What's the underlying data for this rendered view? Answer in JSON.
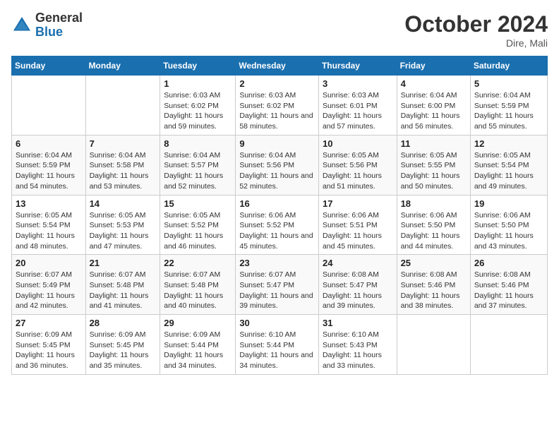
{
  "header": {
    "logo_general": "General",
    "logo_blue": "Blue",
    "month_title": "October 2024",
    "location": "Dire, Mali"
  },
  "days_of_week": [
    "Sunday",
    "Monday",
    "Tuesday",
    "Wednesday",
    "Thursday",
    "Friday",
    "Saturday"
  ],
  "weeks": [
    [
      {
        "day": "",
        "info": ""
      },
      {
        "day": "",
        "info": ""
      },
      {
        "day": "1",
        "info": "Sunrise: 6:03 AM\nSunset: 6:02 PM\nDaylight: 11 hours and 59 minutes."
      },
      {
        "day": "2",
        "info": "Sunrise: 6:03 AM\nSunset: 6:02 PM\nDaylight: 11 hours and 58 minutes."
      },
      {
        "day": "3",
        "info": "Sunrise: 6:03 AM\nSunset: 6:01 PM\nDaylight: 11 hours and 57 minutes."
      },
      {
        "day": "4",
        "info": "Sunrise: 6:04 AM\nSunset: 6:00 PM\nDaylight: 11 hours and 56 minutes."
      },
      {
        "day": "5",
        "info": "Sunrise: 6:04 AM\nSunset: 5:59 PM\nDaylight: 11 hours and 55 minutes."
      }
    ],
    [
      {
        "day": "6",
        "info": "Sunrise: 6:04 AM\nSunset: 5:59 PM\nDaylight: 11 hours and 54 minutes."
      },
      {
        "day": "7",
        "info": "Sunrise: 6:04 AM\nSunset: 5:58 PM\nDaylight: 11 hours and 53 minutes."
      },
      {
        "day": "8",
        "info": "Sunrise: 6:04 AM\nSunset: 5:57 PM\nDaylight: 11 hours and 52 minutes."
      },
      {
        "day": "9",
        "info": "Sunrise: 6:04 AM\nSunset: 5:56 PM\nDaylight: 11 hours and 52 minutes."
      },
      {
        "day": "10",
        "info": "Sunrise: 6:05 AM\nSunset: 5:56 PM\nDaylight: 11 hours and 51 minutes."
      },
      {
        "day": "11",
        "info": "Sunrise: 6:05 AM\nSunset: 5:55 PM\nDaylight: 11 hours and 50 minutes."
      },
      {
        "day": "12",
        "info": "Sunrise: 6:05 AM\nSunset: 5:54 PM\nDaylight: 11 hours and 49 minutes."
      }
    ],
    [
      {
        "day": "13",
        "info": "Sunrise: 6:05 AM\nSunset: 5:54 PM\nDaylight: 11 hours and 48 minutes."
      },
      {
        "day": "14",
        "info": "Sunrise: 6:05 AM\nSunset: 5:53 PM\nDaylight: 11 hours and 47 minutes."
      },
      {
        "day": "15",
        "info": "Sunrise: 6:05 AM\nSunset: 5:52 PM\nDaylight: 11 hours and 46 minutes."
      },
      {
        "day": "16",
        "info": "Sunrise: 6:06 AM\nSunset: 5:52 PM\nDaylight: 11 hours and 45 minutes."
      },
      {
        "day": "17",
        "info": "Sunrise: 6:06 AM\nSunset: 5:51 PM\nDaylight: 11 hours and 45 minutes."
      },
      {
        "day": "18",
        "info": "Sunrise: 6:06 AM\nSunset: 5:50 PM\nDaylight: 11 hours and 44 minutes."
      },
      {
        "day": "19",
        "info": "Sunrise: 6:06 AM\nSunset: 5:50 PM\nDaylight: 11 hours and 43 minutes."
      }
    ],
    [
      {
        "day": "20",
        "info": "Sunrise: 6:07 AM\nSunset: 5:49 PM\nDaylight: 11 hours and 42 minutes."
      },
      {
        "day": "21",
        "info": "Sunrise: 6:07 AM\nSunset: 5:48 PM\nDaylight: 11 hours and 41 minutes."
      },
      {
        "day": "22",
        "info": "Sunrise: 6:07 AM\nSunset: 5:48 PM\nDaylight: 11 hours and 40 minutes."
      },
      {
        "day": "23",
        "info": "Sunrise: 6:07 AM\nSunset: 5:47 PM\nDaylight: 11 hours and 39 minutes."
      },
      {
        "day": "24",
        "info": "Sunrise: 6:08 AM\nSunset: 5:47 PM\nDaylight: 11 hours and 39 minutes."
      },
      {
        "day": "25",
        "info": "Sunrise: 6:08 AM\nSunset: 5:46 PM\nDaylight: 11 hours and 38 minutes."
      },
      {
        "day": "26",
        "info": "Sunrise: 6:08 AM\nSunset: 5:46 PM\nDaylight: 11 hours and 37 minutes."
      }
    ],
    [
      {
        "day": "27",
        "info": "Sunrise: 6:09 AM\nSunset: 5:45 PM\nDaylight: 11 hours and 36 minutes."
      },
      {
        "day": "28",
        "info": "Sunrise: 6:09 AM\nSunset: 5:45 PM\nDaylight: 11 hours and 35 minutes."
      },
      {
        "day": "29",
        "info": "Sunrise: 6:09 AM\nSunset: 5:44 PM\nDaylight: 11 hours and 34 minutes."
      },
      {
        "day": "30",
        "info": "Sunrise: 6:10 AM\nSunset: 5:44 PM\nDaylight: 11 hours and 34 minutes."
      },
      {
        "day": "31",
        "info": "Sunrise: 6:10 AM\nSunset: 5:43 PM\nDaylight: 11 hours and 33 minutes."
      },
      {
        "day": "",
        "info": ""
      },
      {
        "day": "",
        "info": ""
      }
    ]
  ]
}
